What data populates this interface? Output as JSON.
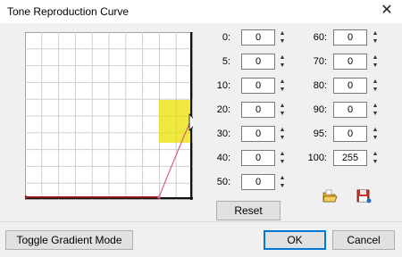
{
  "window": {
    "title": "Tone Reproduction Curve",
    "close_glyph": "✕"
  },
  "left_fields": [
    {
      "label": "0:",
      "value": "0"
    },
    {
      "label": "5:",
      "value": "0"
    },
    {
      "label": "10:",
      "value": "0"
    },
    {
      "label": "20:",
      "value": "0"
    },
    {
      "label": "30:",
      "value": "0"
    },
    {
      "label": "40:",
      "value": "0"
    },
    {
      "label": "50:",
      "value": "0"
    }
  ],
  "right_fields": [
    {
      "label": "60:",
      "value": "0"
    },
    {
      "label": "70:",
      "value": "0"
    },
    {
      "label": "80:",
      "value": "0"
    },
    {
      "label": "90:",
      "value": "0"
    },
    {
      "label": "95:",
      "value": "0"
    },
    {
      "label": "100:",
      "value": "255"
    }
  ],
  "spin": {
    "up": "▲",
    "down": "▼"
  },
  "buttons": {
    "reset": "Reset",
    "toggle_gradient": "Toggle Gradient Mode",
    "ok": "OK",
    "cancel": "Cancel"
  },
  "icons": {
    "open": "folder-open-icon",
    "save": "floppy-save-icon"
  },
  "colors": {
    "curve": "#d9627a",
    "baseline": "#8b1a1a",
    "highlight": "#e8e000",
    "accent": "#0078d7"
  }
}
